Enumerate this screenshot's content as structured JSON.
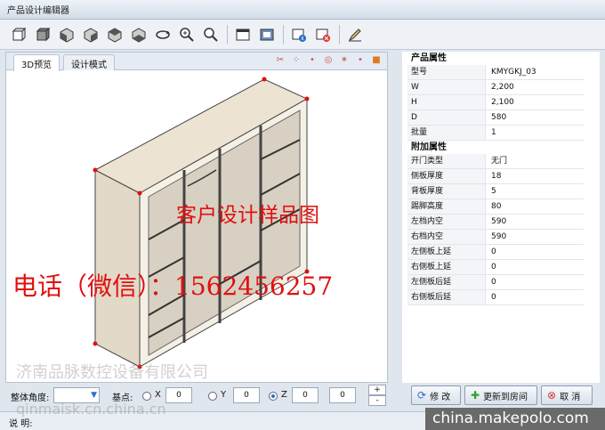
{
  "window": {
    "title": "产品设计编辑器"
  },
  "toolbar": {
    "icons": [
      "box-front-icon",
      "box-back-icon",
      "view-left-icon",
      "view-right-icon",
      "view-top-icon",
      "view-bottom-icon",
      "rotate-icon",
      "zoom-in-icon",
      "zoom-out-icon",
      "window-icon",
      "layout-icon",
      "info-icon",
      "delete-icon",
      "pen-icon"
    ]
  },
  "tabs": [
    {
      "label": "3D预览",
      "active": true
    },
    {
      "label": "设计模式",
      "active": false
    }
  ],
  "properties": {
    "title": "产品属性",
    "rows": [
      {
        "key": "型号",
        "value": "KMYGKJ_03"
      },
      {
        "key": "W",
        "value": "2,200"
      },
      {
        "key": "H",
        "value": "2,100"
      },
      {
        "key": "D",
        "value": "580"
      },
      {
        "key": "批量",
        "value": "1"
      }
    ]
  },
  "extra": {
    "title": "附加属性",
    "rows": [
      {
        "key": "开门类型",
        "value": "无门"
      },
      {
        "key": "侧板厚度",
        "value": "18"
      },
      {
        "key": "背板厚度",
        "value": "5"
      },
      {
        "key": "踢脚高度",
        "value": "80"
      },
      {
        "key": "左档内空",
        "value": "590"
      },
      {
        "key": "右档内空",
        "value": "590"
      },
      {
        "key": "左侧板上延",
        "value": "0"
      },
      {
        "key": "右侧板上延",
        "value": "0"
      },
      {
        "key": "左侧板后延",
        "value": "0"
      },
      {
        "key": "右侧板后延",
        "value": "0"
      }
    ]
  },
  "bottom": {
    "angle_label": "整体角度:",
    "base_label": "基点:",
    "x_label": "X",
    "y_label": "Y",
    "z_label": "Z",
    "x_value": "0",
    "y_value": "0",
    "z_value": "0",
    "extra_value": "0",
    "selected_axis": "Z"
  },
  "buttons": {
    "modify": "修 改",
    "update": "更新到房间",
    "cancel": "取 消"
  },
  "status": {
    "label": "说 明:"
  },
  "overlays": {
    "sample": "客户设计样品图",
    "phone": "电话（微信）：1562456257",
    "watermark_cn": "济南品脉数控设备有限公司",
    "watermark_en": "qinmaisk.cn.china.cn",
    "site": "china.makepolo.com"
  },
  "colors": {
    "accent": "#2a6fc9",
    "overlay_red": "#e01010",
    "frame": "#dfe6ee"
  }
}
